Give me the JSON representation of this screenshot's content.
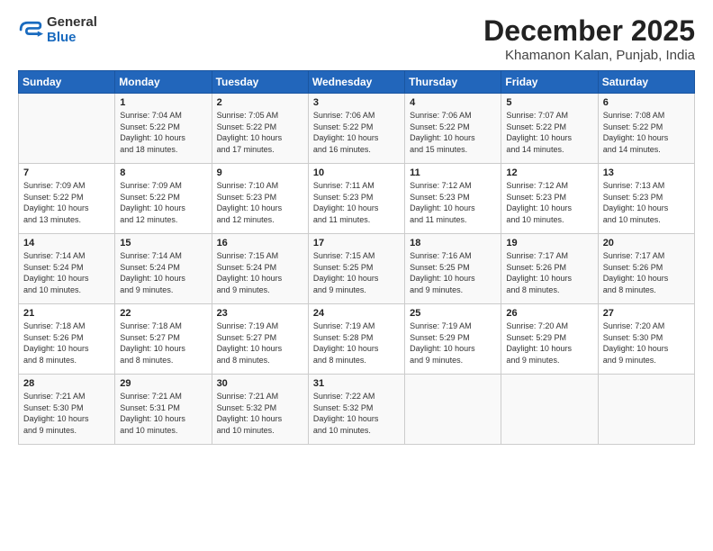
{
  "logo": {
    "line1": "General",
    "line2": "Blue"
  },
  "title": "December 2025",
  "subtitle": "Khamanon Kalan, Punjab, India",
  "days_header": [
    "Sunday",
    "Monday",
    "Tuesday",
    "Wednesday",
    "Thursday",
    "Friday",
    "Saturday"
  ],
  "weeks": [
    [
      {
        "day": "",
        "info": ""
      },
      {
        "day": "1",
        "info": "Sunrise: 7:04 AM\nSunset: 5:22 PM\nDaylight: 10 hours\nand 18 minutes."
      },
      {
        "day": "2",
        "info": "Sunrise: 7:05 AM\nSunset: 5:22 PM\nDaylight: 10 hours\nand 17 minutes."
      },
      {
        "day": "3",
        "info": "Sunrise: 7:06 AM\nSunset: 5:22 PM\nDaylight: 10 hours\nand 16 minutes."
      },
      {
        "day": "4",
        "info": "Sunrise: 7:06 AM\nSunset: 5:22 PM\nDaylight: 10 hours\nand 15 minutes."
      },
      {
        "day": "5",
        "info": "Sunrise: 7:07 AM\nSunset: 5:22 PM\nDaylight: 10 hours\nand 14 minutes."
      },
      {
        "day": "6",
        "info": "Sunrise: 7:08 AM\nSunset: 5:22 PM\nDaylight: 10 hours\nand 14 minutes."
      }
    ],
    [
      {
        "day": "7",
        "info": "Sunrise: 7:09 AM\nSunset: 5:22 PM\nDaylight: 10 hours\nand 13 minutes."
      },
      {
        "day": "8",
        "info": "Sunrise: 7:09 AM\nSunset: 5:22 PM\nDaylight: 10 hours\nand 12 minutes."
      },
      {
        "day": "9",
        "info": "Sunrise: 7:10 AM\nSunset: 5:23 PM\nDaylight: 10 hours\nand 12 minutes."
      },
      {
        "day": "10",
        "info": "Sunrise: 7:11 AM\nSunset: 5:23 PM\nDaylight: 10 hours\nand 11 minutes."
      },
      {
        "day": "11",
        "info": "Sunrise: 7:12 AM\nSunset: 5:23 PM\nDaylight: 10 hours\nand 11 minutes."
      },
      {
        "day": "12",
        "info": "Sunrise: 7:12 AM\nSunset: 5:23 PM\nDaylight: 10 hours\nand 10 minutes."
      },
      {
        "day": "13",
        "info": "Sunrise: 7:13 AM\nSunset: 5:23 PM\nDaylight: 10 hours\nand 10 minutes."
      }
    ],
    [
      {
        "day": "14",
        "info": "Sunrise: 7:14 AM\nSunset: 5:24 PM\nDaylight: 10 hours\nand 10 minutes."
      },
      {
        "day": "15",
        "info": "Sunrise: 7:14 AM\nSunset: 5:24 PM\nDaylight: 10 hours\nand 9 minutes."
      },
      {
        "day": "16",
        "info": "Sunrise: 7:15 AM\nSunset: 5:24 PM\nDaylight: 10 hours\nand 9 minutes."
      },
      {
        "day": "17",
        "info": "Sunrise: 7:15 AM\nSunset: 5:25 PM\nDaylight: 10 hours\nand 9 minutes."
      },
      {
        "day": "18",
        "info": "Sunrise: 7:16 AM\nSunset: 5:25 PM\nDaylight: 10 hours\nand 9 minutes."
      },
      {
        "day": "19",
        "info": "Sunrise: 7:17 AM\nSunset: 5:26 PM\nDaylight: 10 hours\nand 8 minutes."
      },
      {
        "day": "20",
        "info": "Sunrise: 7:17 AM\nSunset: 5:26 PM\nDaylight: 10 hours\nand 8 minutes."
      }
    ],
    [
      {
        "day": "21",
        "info": "Sunrise: 7:18 AM\nSunset: 5:26 PM\nDaylight: 10 hours\nand 8 minutes."
      },
      {
        "day": "22",
        "info": "Sunrise: 7:18 AM\nSunset: 5:27 PM\nDaylight: 10 hours\nand 8 minutes."
      },
      {
        "day": "23",
        "info": "Sunrise: 7:19 AM\nSunset: 5:27 PM\nDaylight: 10 hours\nand 8 minutes."
      },
      {
        "day": "24",
        "info": "Sunrise: 7:19 AM\nSunset: 5:28 PM\nDaylight: 10 hours\nand 8 minutes."
      },
      {
        "day": "25",
        "info": "Sunrise: 7:19 AM\nSunset: 5:29 PM\nDaylight: 10 hours\nand 9 minutes."
      },
      {
        "day": "26",
        "info": "Sunrise: 7:20 AM\nSunset: 5:29 PM\nDaylight: 10 hours\nand 9 minutes."
      },
      {
        "day": "27",
        "info": "Sunrise: 7:20 AM\nSunset: 5:30 PM\nDaylight: 10 hours\nand 9 minutes."
      }
    ],
    [
      {
        "day": "28",
        "info": "Sunrise: 7:21 AM\nSunset: 5:30 PM\nDaylight: 10 hours\nand 9 minutes."
      },
      {
        "day": "29",
        "info": "Sunrise: 7:21 AM\nSunset: 5:31 PM\nDaylight: 10 hours\nand 10 minutes."
      },
      {
        "day": "30",
        "info": "Sunrise: 7:21 AM\nSunset: 5:32 PM\nDaylight: 10 hours\nand 10 minutes."
      },
      {
        "day": "31",
        "info": "Sunrise: 7:22 AM\nSunset: 5:32 PM\nDaylight: 10 hours\nand 10 minutes."
      },
      {
        "day": "",
        "info": ""
      },
      {
        "day": "",
        "info": ""
      },
      {
        "day": "",
        "info": ""
      }
    ]
  ]
}
